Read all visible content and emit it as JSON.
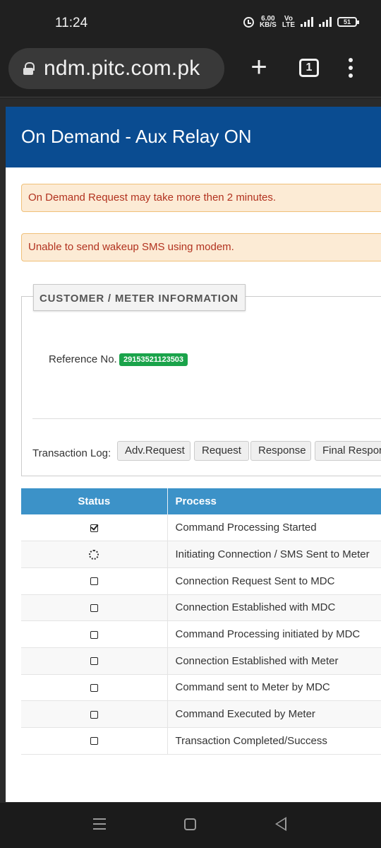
{
  "statusbar": {
    "time": "11:24",
    "netspeed_top": "6.00",
    "netspeed_bottom": "KB/S",
    "battery": "51"
  },
  "browser": {
    "url": "ndm.pitc.com.pk",
    "tab_count": "1"
  },
  "modal": {
    "title": "On Demand - Aux Relay ON",
    "alerts": [
      "On Demand Request may take more then 2 minutes.",
      "Unable to send wakeup SMS using modem."
    ],
    "info": {
      "legend": "CUSTOMER / METER INFORMATION",
      "reference_label": "Reference No.",
      "reference_value": "29153521123503",
      "transaction_log_label": "Transaction Log:",
      "log_buttons": [
        "Adv.Request",
        "Request",
        "Response",
        "Final Respor"
      ]
    },
    "table": {
      "headers": [
        "Status",
        "Process"
      ],
      "rows": [
        {
          "status": "checked",
          "process": "Command Processing Started"
        },
        {
          "status": "loading",
          "process": "Initiating Connection / SMS Sent to Meter"
        },
        {
          "status": "unchecked",
          "process": "Connection Request Sent to MDC"
        },
        {
          "status": "unchecked",
          "process": "Connection Established with MDC"
        },
        {
          "status": "unchecked",
          "process": "Command Processing initiated by MDC"
        },
        {
          "status": "unchecked",
          "process": "Connection Established with Meter"
        },
        {
          "status": "unchecked",
          "process": "Command sent to Meter by MDC"
        },
        {
          "status": "unchecked",
          "process": "Command Executed by Meter"
        },
        {
          "status": "unchecked",
          "process": "Transaction Completed/Success"
        }
      ]
    }
  }
}
